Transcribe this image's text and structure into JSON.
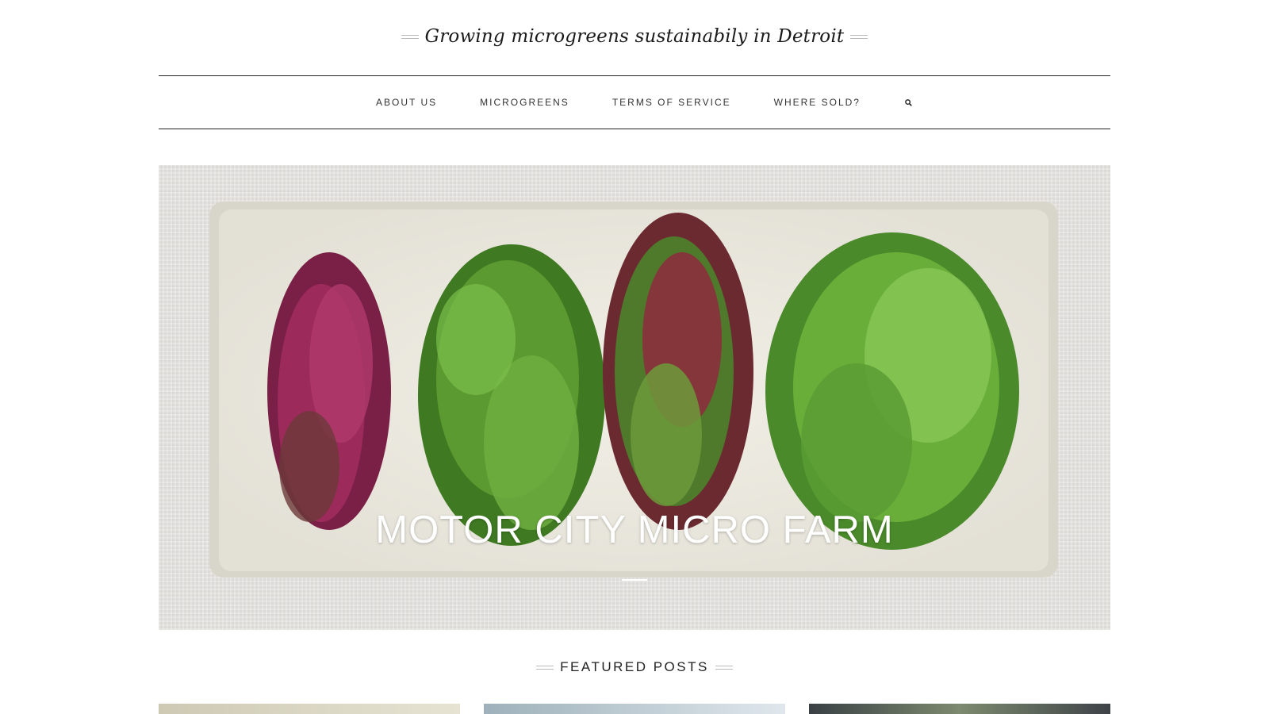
{
  "header": {
    "tagline": "Growing microgreens sustainabily in Detroit"
  },
  "nav": {
    "items": [
      {
        "label": "ABOUT US"
      },
      {
        "label": "MICROGREENS"
      },
      {
        "label": "TERMS OF SERVICE"
      },
      {
        "label": "WHERE SOLD?"
      }
    ],
    "search_icon": "search-icon"
  },
  "hero": {
    "title": "MOTOR CITY MICRO FARM"
  },
  "featured": {
    "title": "FEATURED POSTS"
  },
  "colors": {
    "text": "#222222",
    "hero_title": "#ffffff",
    "rule": "#222222"
  }
}
